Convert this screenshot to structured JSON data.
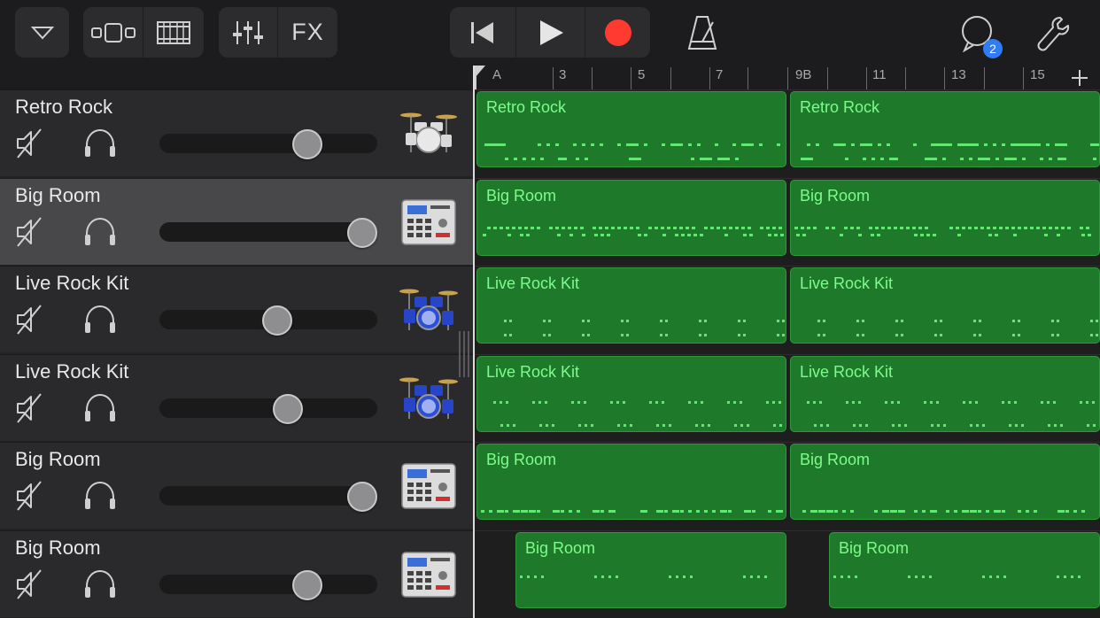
{
  "toolbar": {
    "browser_button_icon": "triangle-down-icon",
    "views": [
      {
        "name": "tracks-view",
        "icon": "tracks-view-icon"
      },
      {
        "name": "live-loops",
        "icon": "live-loops-grid-icon"
      }
    ],
    "mixer_icon": "mixer-sliders-icon",
    "fx_label": "FX",
    "transport": {
      "rewind_icon": "skip-back-icon",
      "play_icon": "play-icon",
      "record_icon": "record-icon"
    },
    "metronome_icon": "metronome-icon",
    "loops_icon": "loop-browser-icon",
    "loops_badge": "2",
    "settings_icon": "wrench-icon"
  },
  "ruler": {
    "labels": [
      "A",
      "3",
      "5",
      "7",
      "9B",
      "11",
      "13",
      "15"
    ],
    "add_section_icon": "plus-icon"
  },
  "tracks": [
    {
      "name": "Retro Rock",
      "instrument": "drum-kit-icon",
      "volume": 0.68,
      "selected": false,
      "regions": [
        "Retro Rock",
        "Retro Rock"
      ],
      "pattern": "retro"
    },
    {
      "name": "Big Room",
      "instrument": "beat-sequencer-icon",
      "volume": 0.93,
      "selected": true,
      "regions": [
        "Big Room",
        "Big Room"
      ],
      "pattern": "bigroom1"
    },
    {
      "name": "Live Rock Kit",
      "instrument": "blue-drum-kit-icon",
      "volume": 0.54,
      "selected": false,
      "regions": [
        "Live Rock Kit",
        "Live Rock Kit"
      ],
      "pattern": "live1"
    },
    {
      "name": "Live Rock Kit",
      "instrument": "blue-drum-kit-icon",
      "volume": 0.59,
      "selected": false,
      "regions": [
        "Live Rock Kit",
        "Live Rock Kit"
      ],
      "pattern": "live2"
    },
    {
      "name": "Big Room",
      "instrument": "beat-sequencer-icon",
      "volume": 0.93,
      "selected": false,
      "regions": [
        "Big Room",
        "Big Room"
      ],
      "pattern": "bigroom2"
    },
    {
      "name": "Big Room",
      "instrument": "beat-sequencer-icon",
      "volume": 0.68,
      "selected": false,
      "regions": [
        "Big Room",
        "Big Room"
      ],
      "pattern": "bigroom3"
    }
  ],
  "colors": {
    "record": "#ff3b30",
    "region_fill": "#1e7a2a",
    "region_text": "#7dfc8c",
    "badge": "#2f7cf6"
  }
}
